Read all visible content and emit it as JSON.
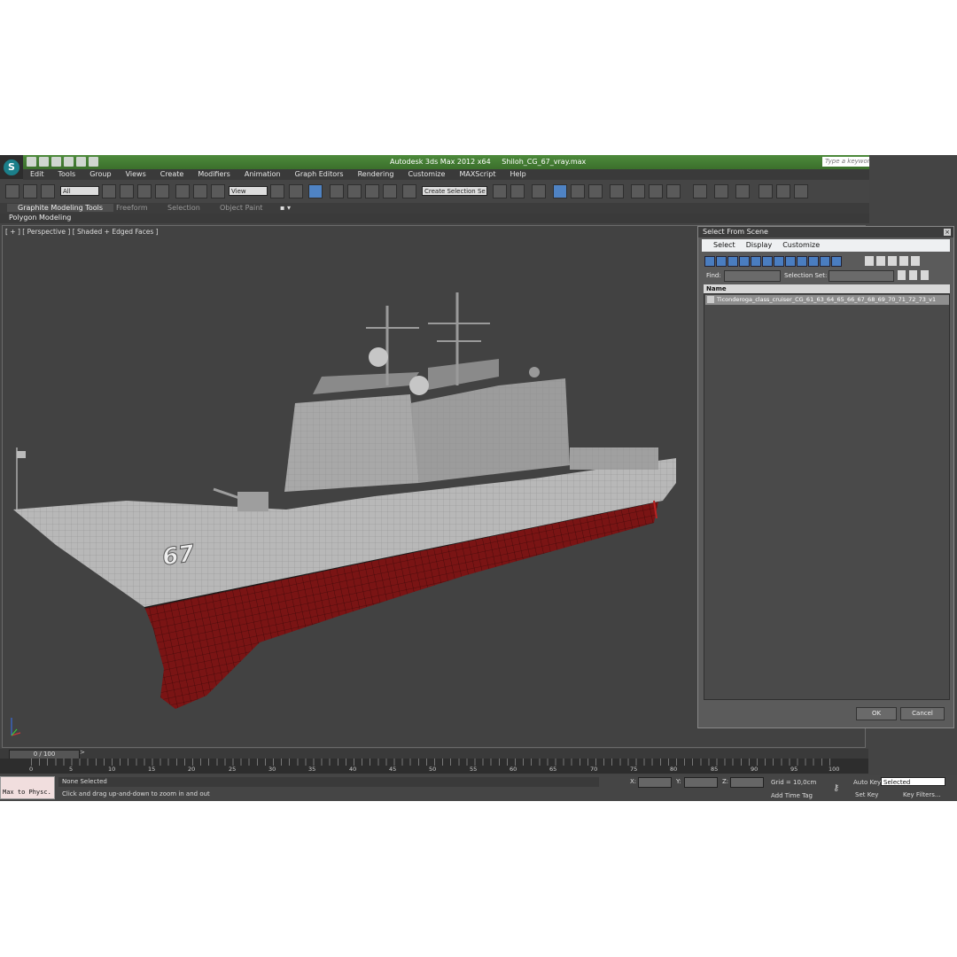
{
  "window": {
    "app_title": "Autodesk 3ds Max  2012 x64",
    "file_name": "Shiloh_CG_67_vray.max",
    "search_placeholder": "Type a keyword or phrase"
  },
  "menu": [
    "Edit",
    "Tools",
    "Group",
    "Views",
    "Create",
    "Modifiers",
    "Animation",
    "Graph Editors",
    "Rendering",
    "Customize",
    "MAXScript",
    "Help"
  ],
  "toolbar": {
    "selection_filter": "All",
    "reference_coord": "View",
    "named_selection": "Create Selection Se"
  },
  "ribbon": {
    "tabs": [
      "Graphite Modeling Tools",
      "Freeform",
      "Selection",
      "Object Paint"
    ],
    "active_tab": "Graphite Modeling Tools",
    "panel": "Polygon Modeling"
  },
  "viewport": {
    "label": "[ + ] [ Perspective ] [ Shaded + Edged Faces ]",
    "hull_number": "67"
  },
  "dialog": {
    "title": "Select From Scene",
    "menu": [
      "Select",
      "Display",
      "Customize"
    ],
    "find_label": "Find:",
    "selection_set_label": "Selection Set:",
    "column_header": "Name",
    "items": [
      "Ticonderoga_class_cruiser_CG_61_63_64_65_66_67_68_69_70_71_72_73_v1"
    ],
    "ok_label": "OK",
    "cancel_label": "Cancel"
  },
  "timeline": {
    "frame_display": "0 / 100",
    "next_arrow": ">",
    "ticks": [
      "0",
      "5",
      "10",
      "15",
      "20",
      "25",
      "30",
      "35",
      "40",
      "45",
      "50",
      "55",
      "60",
      "65",
      "70",
      "75",
      "80",
      "85",
      "90",
      "95",
      "100"
    ]
  },
  "status": {
    "maxscript_text": "Max to Physc.",
    "selection_status": "None Selected",
    "prompt": "Click and drag up-and-down to zoom in and out",
    "x_label": "X:",
    "y_label": "Y:",
    "z_label": "Z:",
    "grid": "Grid = 10,0cm",
    "add_time_tag": "Add Time Tag",
    "auto_key": "Auto Key",
    "set_key": "Set Key",
    "key_mode": "Selected",
    "key_filters": "Key Filters..."
  },
  "colors": {
    "titlebar": "#4a8739",
    "hull_top": "#b8b8b8",
    "hull_bottom": "#7a1414",
    "viewport_bg": "#424242",
    "dialog_bg": "#5b5b5b"
  }
}
